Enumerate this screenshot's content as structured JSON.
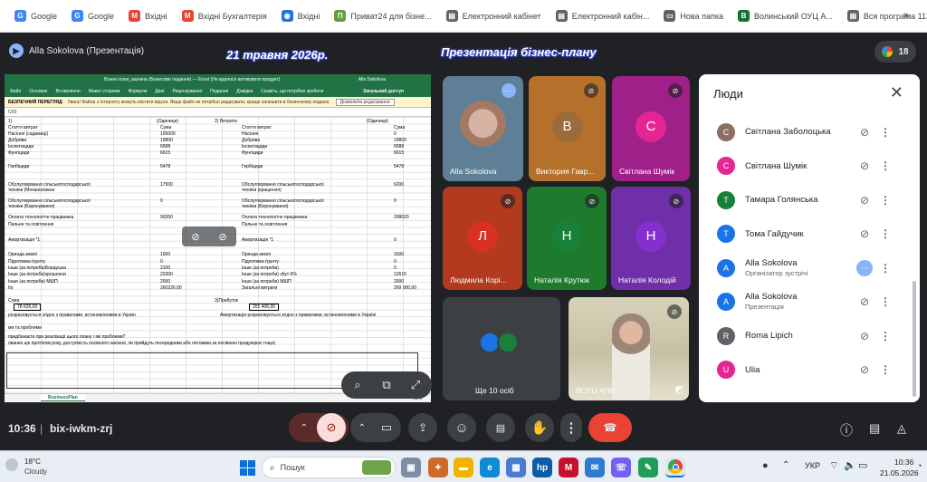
{
  "bookmarks": [
    {
      "label": "Google",
      "icon": "google-icon",
      "color": "#4285f4",
      "glyph": "G"
    },
    {
      "label": "Google",
      "icon": "google-icon",
      "color": "#4285f4",
      "glyph": "G"
    },
    {
      "label": "Вхідні",
      "icon": "gmail-icon",
      "color": "#ea4335",
      "glyph": "M"
    },
    {
      "label": "Вхідні Бухгалтерія",
      "icon": "gmail-icon",
      "color": "#ea4335",
      "glyph": "M"
    },
    {
      "label": "Вхідні",
      "icon": "globe-icon",
      "color": "#1a73e8",
      "glyph": "◉"
    },
    {
      "label": "Приват24 для бізне...",
      "icon": "privat-icon",
      "color": "#5f9e3e",
      "glyph": "П"
    },
    {
      "label": "Електронний кабінет",
      "icon": "doc-icon",
      "color": "#5f6368",
      "glyph": "▤"
    },
    {
      "label": "Електронний кабін...",
      "icon": "doc-icon",
      "color": "#5f6368",
      "glyph": "▤"
    },
    {
      "label": "Нова папка",
      "icon": "folder-icon",
      "color": "#5f6368",
      "glyph": "▭"
    },
    {
      "label": "Волинський ОУЦ А...",
      "icon": "ouc-icon",
      "color": "#137333",
      "glyph": "В"
    },
    {
      "label": "Вся програма 1130...",
      "icon": "doc-icon",
      "color": "#5f6368",
      "glyph": "▤"
    }
  ],
  "bookmarks_more": "»",
  "header": {
    "presenter": "Alla Sokolova (Презентація)",
    "date_overlay": "21 травня 2026р.",
    "title_overlay": "Презентація бізнес-плану",
    "participant_count": "18"
  },
  "excel": {
    "title": "Бізнес-план_малина (Бізнесове подання) — Excel (Не вдалося активувати продукт)",
    "user": "Alla Sokolova",
    "ribbon": [
      "Файл",
      "Основне",
      "Вставлення",
      "Макет сторінки",
      "Формули",
      "Дані",
      "Рецензування",
      "Подання",
      "Довідка",
      "Скажіть, що потрібно зробити"
    ],
    "share": "Загальний доступ",
    "warn_label": "БЕЗПЕЧНИЙ ПЕРЕГЛЯД",
    "warn_text": "Увага! Файли з Інтернету можуть містити віруси. Якщо файл не потрібно редагувати, краще залишити в безпечному поданні.",
    "warn_button": "Дозволити редагування",
    "cellref": "O20",
    "tab": "BusinessPlan",
    "status_left": "Готово",
    "zoom": "60%",
    "units": "(Одиниця)",
    "rows_left": [
      "Стаття витрат",
      "Насіння (саджанці)",
      "Добрива",
      "Інсектициди",
      "Фунгіциди",
      "",
      "Гербіциди",
      "",
      "Обслуговування сільськогосподарської техніки (Механізована",
      "Обслуговування сільськогосподарської техніки (Боронування)",
      "",
      "Оплата технологічн працівника",
      "Пальне та освітлення",
      "",
      "Амортизація *1",
      "",
      "Оренда землі",
      "Підготовка ґрунту",
      "Інше (за потреби)Борідська",
      "Інше (за потреби)зрошення",
      "Інше (за потреби) МШП",
      "Ito"
    ],
    "vals_left": [
      "Сума",
      "105000",
      "19800",
      "6588",
      "6615",
      "",
      "5478",
      "",
      "17500",
      "0",
      "",
      "90350",
      "",
      "",
      "",
      "",
      "1500",
      "0",
      "2100",
      "22300",
      "2000",
      "260226,00"
    ],
    "rows_right": [
      "Стаття витрат",
      "Насіння",
      "Добрива",
      "Інсектициди",
      "Фунгіциди",
      "",
      "Гербіциди",
      "",
      "Обслуговування сільськогосподарської техніки (кращення)",
      "Обслуговування сільськогосподарської техніки (Боронування)",
      "",
      "Оплата технологічн працівника",
      "Пальне та освітлення",
      "",
      "Амортизація *1",
      "",
      "Оренда землі",
      "Підготовка ґрунту",
      "Інше (за потреби)",
      "Інше (за потреби) збут 5%",
      "Інше (за потреби) МШП",
      "Загальні витрати"
    ],
    "vals_right": [
      "Сума",
      "0",
      "19800",
      "6588",
      "6615",
      "",
      "5478",
      "",
      "6200",
      "0",
      "",
      "208020",
      "",
      "",
      "0",
      "",
      "1500",
      "0",
      "0",
      "12615",
      "2000",
      "269 000,00"
    ],
    "label_income": "Сума",
    "val_income_left": "78 626,00",
    "label_profit": "3)Прибуток",
    "val_income_right": "201 406,00",
    "note_amort": "розраховується згідно з правилами, встановленими в Україн",
    "note_amort_right": "Амортизація розраховується згідно з правилами, встановленими в Україні",
    "note_problems": "ми та проблеми",
    "note_q1": "предбачаєте при реалізації цього плану і які проблеми?",
    "note_q2": "ованих цін протягом року, доступність посівного насіння, чи прийдуть посередники або оптовики за посівною продукцією тощо)",
    "header_left": "1)",
    "header_right": "2) Витрати"
  },
  "share_controls": [
    "zoom-icon",
    "popout-icon",
    "fullscreen-icon"
  ],
  "tiles": [
    {
      "name": "Alla Sokolova",
      "type": "photo",
      "color": "#6d8fa8"
    },
    {
      "name": "Виктория Гавр...",
      "type": "avatar",
      "letter": "В",
      "color": "#9b6b3a",
      "bg": "#b5702c"
    },
    {
      "name": "Світлана Шумік",
      "type": "avatar",
      "letter": "С",
      "color": "#e52592",
      "bg": "#a0208a"
    },
    {
      "name": "Людмила Корі...",
      "type": "avatar",
      "letter": "Л",
      "color": "#d93025",
      "bg": "#b23a1e"
    },
    {
      "name": "Наталія Крутюк",
      "type": "avatar",
      "letter": "Н",
      "color": "#188038",
      "bg": "#1e7b2e"
    },
    {
      "name": "Наталія Колодій",
      "type": "avatar",
      "letter": "Н",
      "color": "#8430ce",
      "bg": "#6f2fa8"
    },
    {
      "name": "Ще 10 осіб",
      "type": "group"
    },
    {
      "name": "ВОУЦ АПК",
      "type": "camera"
    }
  ],
  "people": {
    "title": "Люди",
    "list": [
      {
        "name": "Світлана Заболоцька",
        "sub": "",
        "letter": "С",
        "color": "#8d6e63",
        "status": "muted"
      },
      {
        "name": "Світлана Шумік",
        "sub": "",
        "letter": "С",
        "color": "#e52592",
        "status": "muted"
      },
      {
        "name": "Тамара Голянська",
        "sub": "",
        "letter": "Т",
        "color": "#188038",
        "status": "muted"
      },
      {
        "name": "Тома Гайдучик",
        "sub": "",
        "letter": "Т",
        "color": "#1a73e8",
        "status": "muted"
      },
      {
        "name": "Alla Sokolova",
        "sub": "Організатор зустрічі",
        "letter": "A",
        "color": "#1a73e8",
        "status": "speaking"
      },
      {
        "name": "Alla Sokolova",
        "sub": "Презентація",
        "letter": "A",
        "color": "#1a73e8",
        "status": "muted"
      },
      {
        "name": "Roma Lipich",
        "sub": "",
        "letter": "R",
        "color": "#5f6368",
        "status": "muted"
      },
      {
        "name": "Ulia",
        "sub": "",
        "letter": "U",
        "color": "#e52592",
        "status": "muted"
      }
    ]
  },
  "bottom": {
    "time": "10:36",
    "code": "bix-iwkm-zrj"
  },
  "taskbar": {
    "weather_temp": "18°C",
    "weather_desc": "Cloudy",
    "search": "Пошук",
    "lang": "УКР",
    "time": "10:36",
    "date": "21.05.2026"
  }
}
